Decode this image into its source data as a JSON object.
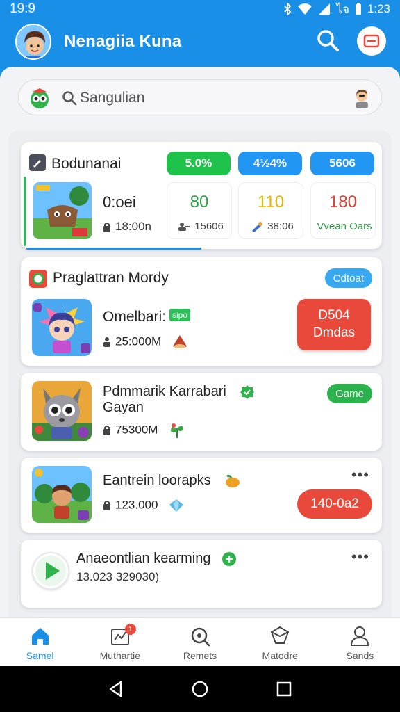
{
  "status_bar": {
    "time": "19:9",
    "right_text": "1:23",
    "carrier": "ไจ"
  },
  "header": {
    "title": "Nenagiia Kuna"
  },
  "search": {
    "placeholder": "Sangulian"
  },
  "card1": {
    "title": "Bodunanai",
    "item_name": "0:oei",
    "item_meta": "18:00n",
    "pills": [
      {
        "label": "5.0%",
        "color": "#1fc24a"
      },
      {
        "label": "4½4%",
        "color": "#2196f3"
      },
      {
        "label": "5606",
        "color": "#2196f3"
      }
    ],
    "stats": [
      {
        "value": "80",
        "sub": "15606",
        "color": "#2e9e44"
      },
      {
        "value": "110",
        "sub": "38:06",
        "color": "#e8b400"
      },
      {
        "value": "180",
        "sub": "Vvean Oars",
        "color": "#d9443a"
      }
    ],
    "progress": 0.5
  },
  "card2": {
    "title": "Praglattran Mordy",
    "badge": "Cdtoat",
    "item_name": "Omelbari:",
    "tag": "sipo",
    "item_meta": "25:000M",
    "button_line1": "D504",
    "button_line2": "Dmdas"
  },
  "card3": {
    "item_name": "Pdmmarik Karrabari",
    "item_name_line2": "Gayan",
    "item_meta": "75300M",
    "button": "Game"
  },
  "card4": {
    "item_name": "Eantrein loorapks",
    "item_meta": "123.000",
    "button": "140-0a2",
    "more": "•••"
  },
  "card5": {
    "item_name": "Anaeontlian kearming",
    "item_meta": "13.023 329030)",
    "more": "•••"
  },
  "bottom_nav": [
    {
      "label": "Samel",
      "icon": "home-icon",
      "active": true
    },
    {
      "label": "Muthartie",
      "icon": "chart-icon",
      "badge": "1"
    },
    {
      "label": "Remets",
      "icon": "search-icon"
    },
    {
      "label": "Matodre",
      "icon": "shield-icon"
    },
    {
      "label": "Sands",
      "icon": "person-icon"
    }
  ]
}
